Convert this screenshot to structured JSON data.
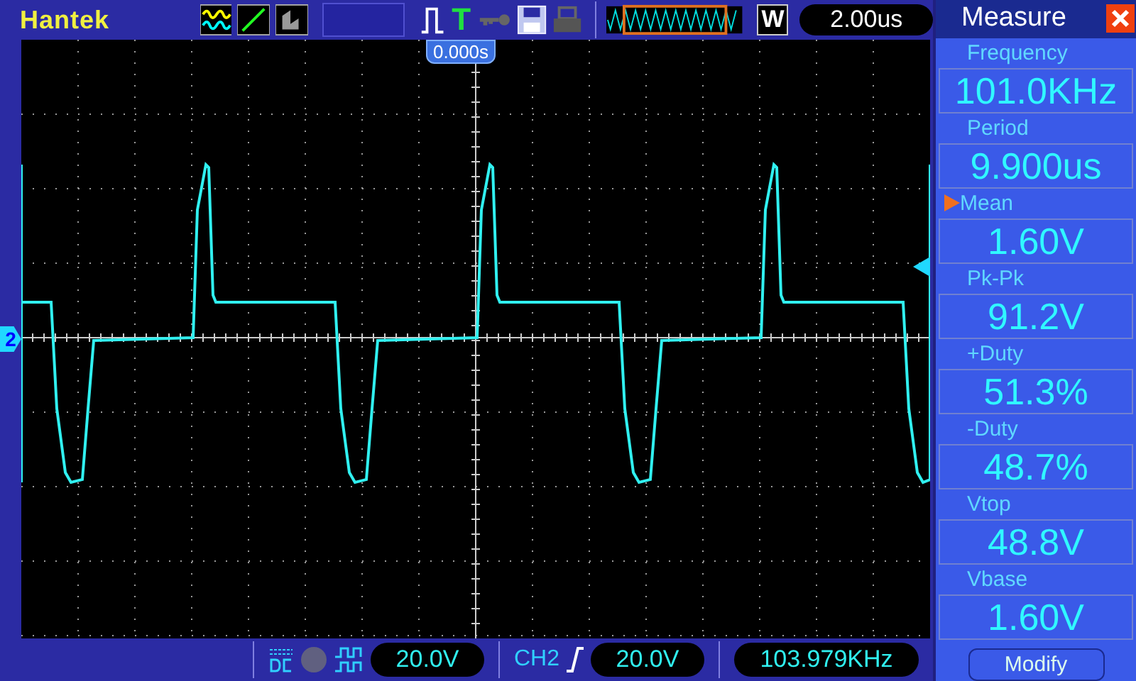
{
  "header": {
    "brand": "Hantek",
    "trigger_letter": "T",
    "mode_letter": "W",
    "timebase": "2.00us"
  },
  "screen": {
    "trigger_position": "0.000s",
    "channel_marker": "2"
  },
  "measure": {
    "title": "Measure",
    "items": [
      {
        "label": "Frequency",
        "value": "101.0KHz",
        "selected": false
      },
      {
        "label": "Period",
        "value": "9.900us",
        "selected": false
      },
      {
        "label": "Mean",
        "value": "1.60V",
        "selected": true
      },
      {
        "label": "Pk-Pk",
        "value": "91.2V",
        "selected": false
      },
      {
        "label": "+Duty",
        "value": "51.3%",
        "selected": false
      },
      {
        "label": "-Duty",
        "value": "48.7%",
        "selected": false
      },
      {
        "label": "Vtop",
        "value": "48.8V",
        "selected": false
      },
      {
        "label": "Vbase",
        "value": "1.60V",
        "selected": false
      }
    ],
    "button": "Modify"
  },
  "footer": {
    "channel_scale": "20.0V",
    "trigger_source": "CH2",
    "trigger_level": "20.0V",
    "frequency": "103.979KHz"
  }
}
